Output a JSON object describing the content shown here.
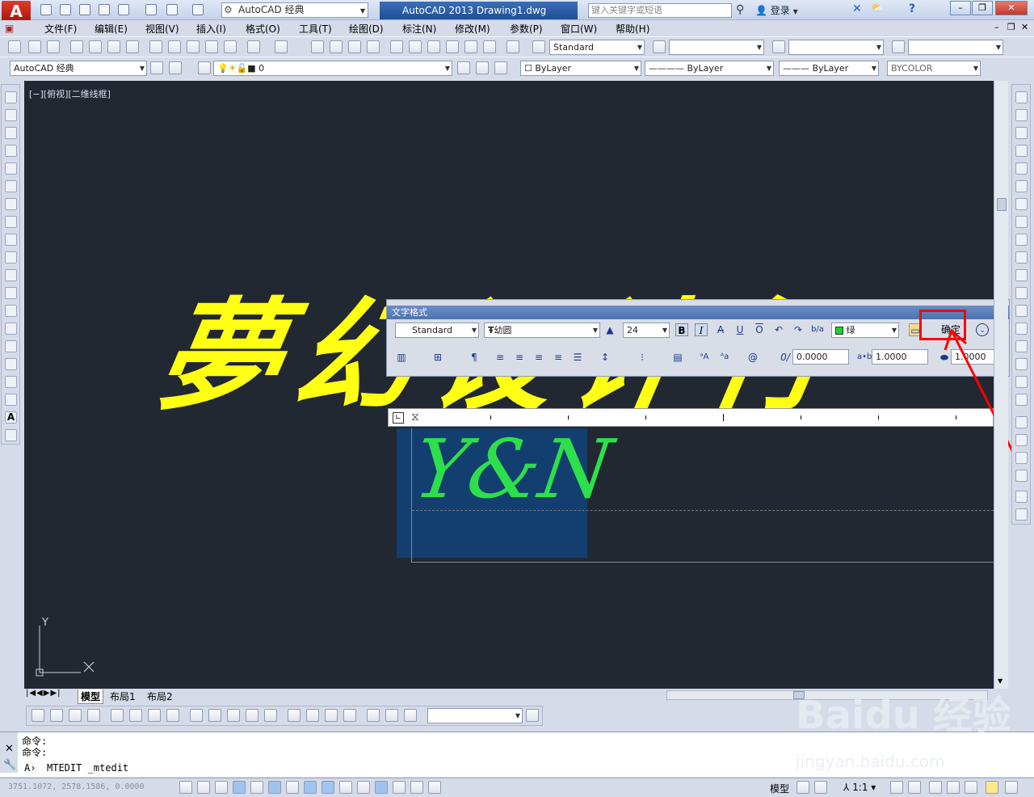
{
  "app": {
    "title": "AutoCAD 2013     Drawing1.dwg",
    "workspace": "AutoCAD 经典",
    "search_placeholder": "键入关键字或短语",
    "login": "登录"
  },
  "menu": [
    "文件(F)",
    "编辑(E)",
    "视图(V)",
    "插入(I)",
    "格式(O)",
    "工具(T)",
    "绘图(D)",
    "标注(N)",
    "修改(M)",
    "参数(P)",
    "窗口(W)",
    "帮助(H)"
  ],
  "toolbar": {
    "text_style": "Standard",
    "workspace2": "AutoCAD 经典",
    "layer": "0",
    "color": "ByLayer",
    "linetype": "ByLayer",
    "lineweight": "ByLayer",
    "plotstyle": "BYCOLOR"
  },
  "viewport_label": "[−][俯视][二维线框]",
  "drawing_text": "夢幻设计行",
  "text_format": {
    "title": "文字格式",
    "style": "Standard",
    "font": "幼圆",
    "height": "24",
    "bold": "B",
    "italic": "I",
    "underline": "U",
    "overline": "O",
    "color": "绿",
    "ok": "确定",
    "oblique": "0.0000",
    "tracking": "1.0000",
    "width_factor": "1.0000"
  },
  "editor_text": "Y&N",
  "ucs": {
    "y": "Y"
  },
  "tabs": [
    "模型",
    "布局1",
    "布局2"
  ],
  "command": {
    "line1": "命令:",
    "line2": "命令:",
    "current": "MTEDIT _mtedit"
  },
  "status": {
    "coords": "3751.1072, 2578.1586, 0.0000",
    "model": "模型",
    "scale": "1:1"
  },
  "watermark": {
    "brand": "Baidu 经验",
    "url": "jingyan.baidu.com"
  },
  "colors": {
    "highlight": "#ff0000",
    "drawing_text": "#ffff14",
    "editor_text": "#2de04b",
    "background": "#222832"
  }
}
